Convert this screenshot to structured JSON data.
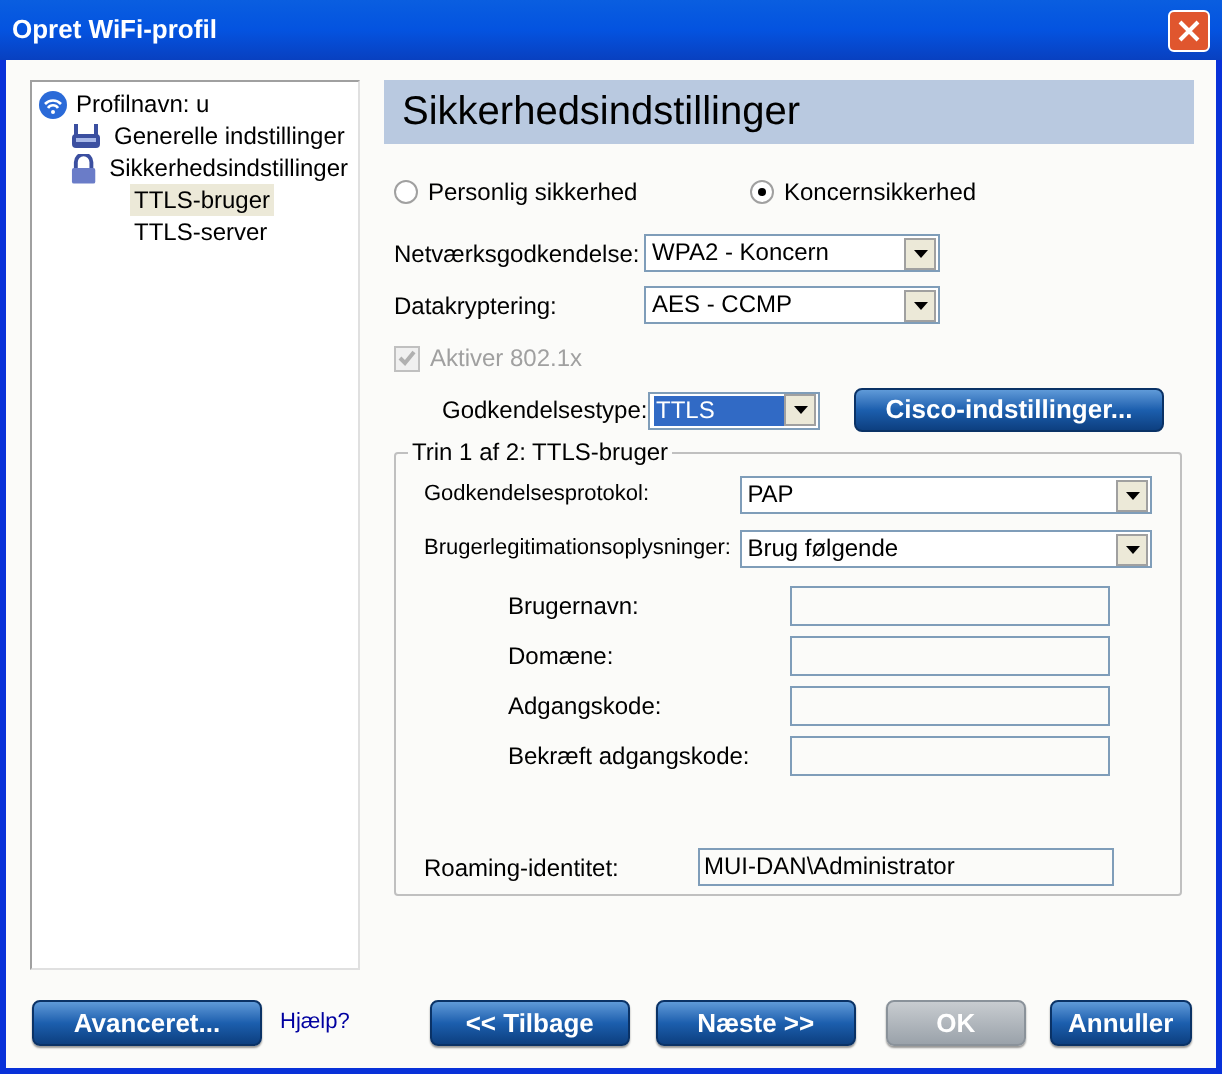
{
  "window": {
    "title": "Opret WiFi-profil"
  },
  "tree": {
    "root": {
      "label": "Profilnavn: u",
      "children": [
        {
          "label": "Generelle indstillinger",
          "kind": "router",
          "selected": false
        },
        {
          "label": "Sikkerhedsindstillinger",
          "kind": "lock",
          "selected": false,
          "children": [
            {
              "label": "TTLS-bruger",
              "selected": true
            },
            {
              "label": "TTLS-server",
              "selected": false
            }
          ]
        }
      ]
    }
  },
  "header": "Sikkerhedsindstillinger",
  "security_mode": [
    {
      "label": "Personlig sikkerhed",
      "selected": false
    },
    {
      "label": "Koncernsikkerhed",
      "selected": true
    }
  ],
  "network_auth": {
    "label": "Netværksgodkendelse:",
    "value": "WPA2 - Koncern"
  },
  "encryption": {
    "label": "Datakryptering:",
    "value": "AES - CCMP"
  },
  "enable_8021x": {
    "label": "Aktiver 802.1x",
    "checked": true,
    "disabled": true
  },
  "auth_type": {
    "label": "Godkendelsestype:",
    "value": "TTLS",
    "selected": true
  },
  "cisco_button": "Cisco-indstillinger...",
  "group": {
    "legend": "Trin 1 af 2: TTLS-bruger",
    "selects": [
      {
        "label": "Godkendelsesprotokol:",
        "value": "PAP"
      },
      {
        "label": "Brugerlegitimationsoplysninger:",
        "value": "Brug følgende"
      }
    ],
    "fields": [
      {
        "label": "Brugernavn:"
      },
      {
        "label": "Domæne:"
      },
      {
        "label": "Adgangskode:"
      },
      {
        "label": "Bekræft adgangskode:"
      }
    ],
    "roaming": {
      "label": "Roaming-identitet:",
      "value": "MUI-DAN\\Administrator"
    }
  },
  "buttons": [
    {
      "label": "Avanceret...",
      "disabled": false
    },
    {
      "label": "<< Tilbage",
      "disabled": false
    },
    {
      "label": "Næste >>",
      "disabled": false
    },
    {
      "label": "OK",
      "disabled": true
    },
    {
      "label": "Annuller",
      "disabled": false
    }
  ],
  "help_link": "Hjælp?"
}
